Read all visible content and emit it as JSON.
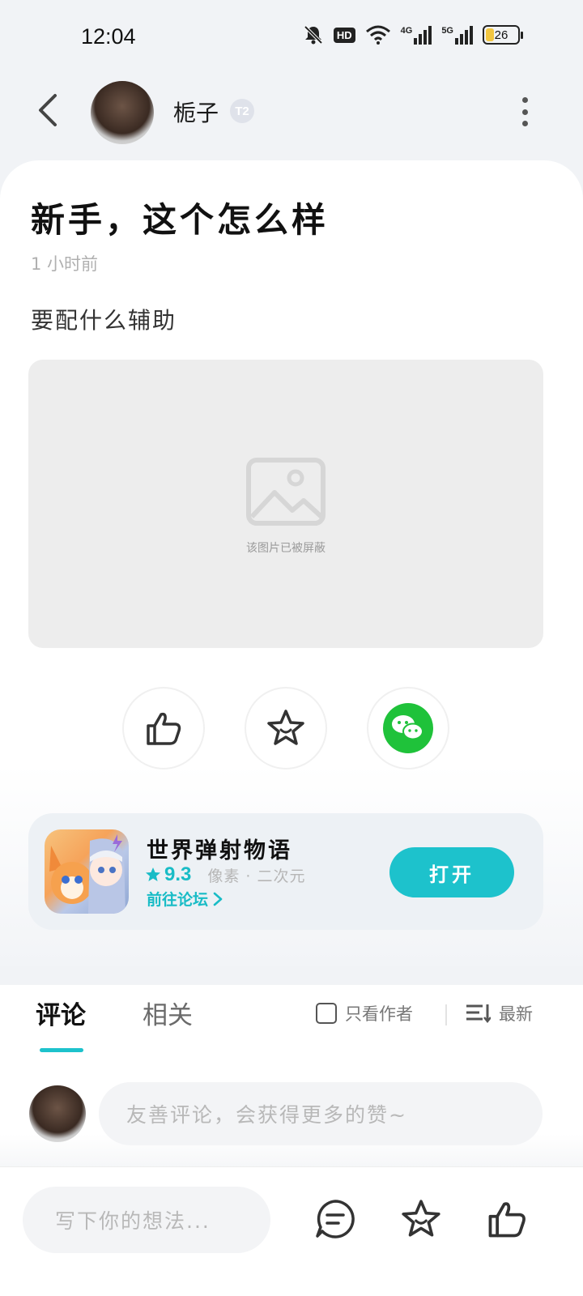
{
  "status_bar": {
    "time": "12:04",
    "hd_label": "HD",
    "net_4g": "4G",
    "net_5g": "5G",
    "battery_level": "26"
  },
  "header": {
    "username": "栀子",
    "level_badge": "T2"
  },
  "post": {
    "title": "新手，这个怎么样",
    "time_ago": "1 小时前",
    "body": "要配什么辅助",
    "blocked_image_text": "该图片已被屏蔽"
  },
  "game": {
    "title": "世界弹射物语",
    "rating": "9.3",
    "tags": "像素 · 二次元",
    "forum_link": "前往论坛",
    "open_label": "打开"
  },
  "comments": {
    "tab_comments": "评论",
    "tab_related": "相关",
    "author_only": "只看作者",
    "sort_label": "最新",
    "input_placeholder": "友善评论，会获得更多的赞~"
  },
  "bottom_bar": {
    "thought_placeholder": "写下你的想法..."
  },
  "colors": {
    "accent": "#1dc2cc",
    "wechat": "#1fc23a"
  }
}
